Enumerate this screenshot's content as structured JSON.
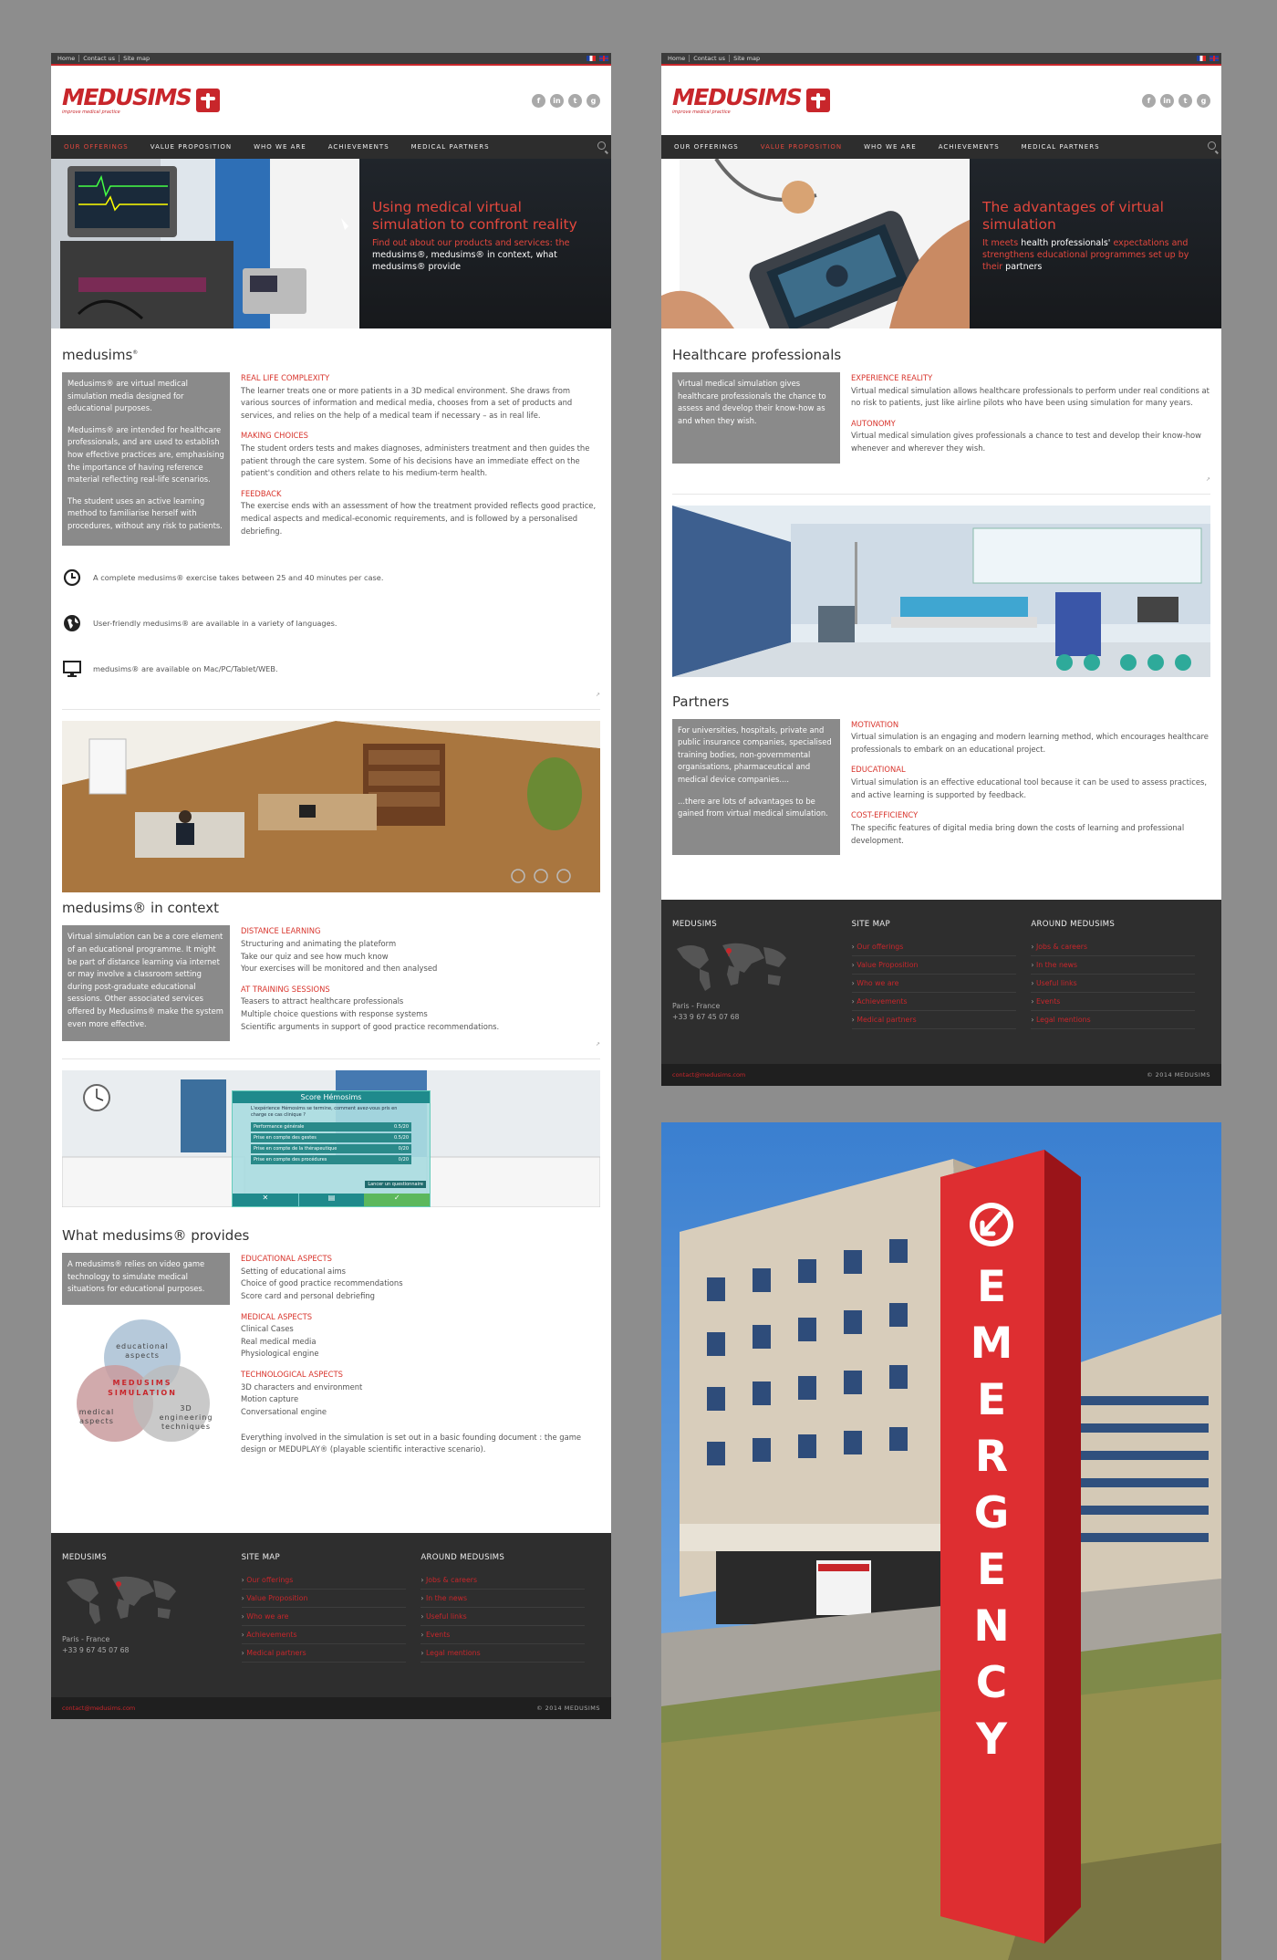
{
  "left_page": {
    "topbar": {
      "links": [
        "Home",
        "Contact us",
        "Site map"
      ]
    },
    "logo": {
      "wordmark": "MEDUSIMS",
      "tagline": "improve medical practice"
    },
    "social_icons": [
      "facebook-icon",
      "linkedin-icon",
      "twitter-icon",
      "googleplus-icon"
    ],
    "nav": {
      "items": [
        "OUR OFFERINGS",
        "VALUE PROPOSITION",
        "WHO WE ARE",
        "ACHIEVEMENTS",
        "MEDICAL PARTNERS"
      ],
      "active": 0
    },
    "hero": {
      "title": "Using medical virtual simulation to confront reality",
      "sub_red": "Find out about our products and services: the",
      "sub_white": "medusims®, medusims® in context, what medusims® provide"
    },
    "section1": {
      "title": "medusims",
      "grey": [
        "Medusims® are virtual medical simulation media designed for educational purposes.",
        "Medusims® are intended for healthcare professionals, and are used to establish how effective practices are, emphasising the importance of having reference material reflecting real-life scenarios.",
        "The student uses an active learning method to familiarise herself with procedures, without any risk to patients."
      ],
      "items": [
        {
          "title": "REAL LIFE COMPLEXITY",
          "text": "The learner treats one or more patients in a 3D medical environment. She draws from various sources of information and medical media, chooses from a set of products and services, and relies on the help of a medical team if necessary – as in real life."
        },
        {
          "title": "MAKING CHOICES",
          "text": "The student orders tests and makes diagnoses, administers treatment and then guides the patient through the care system. Some of his decisions have an immediate effect on the patient's condition and others relate to his medium-term health."
        },
        {
          "title": "FEEDBACK",
          "text": "The exercise ends with an assessment of how the treatment provided reflects good practice, medical aspects and medical-economic requirements, and is followed by a personalised debriefing."
        }
      ]
    },
    "info": [
      {
        "icon": "clock-icon",
        "text": "A complete medusims® exercise takes between 25 and 40 minutes per case."
      },
      {
        "icon": "globe-icon",
        "text": "User-friendly medusims® are available in a variety of languages."
      },
      {
        "icon": "monitor-icon",
        "text": "medusims® are available on Mac/PC/Tablet/WEB."
      }
    ],
    "section2": {
      "title": "medusims® in context",
      "grey": "Virtual simulation can be a core element of an educational programme. It might be part of distance learning via internet or may involve a classroom setting during post-graduate educational sessions. Other associated services offered by Medusims® make the system even more effective.",
      "items": [
        {
          "title": "DISTANCE LEARNING",
          "lines": [
            "Structuring and animating the plateform",
            "Take our quiz and see how much know",
            "Your exercises will be monitored and then analysed"
          ]
        },
        {
          "title": "AT TRAINING SESSIONS",
          "lines": [
            "Teasers to attract healthcare professionals",
            "Multiple choice questions with response systems",
            "Scientific arguments in support of good practice recommendations."
          ]
        }
      ]
    },
    "score_panel": {
      "title": "Score Hémosims",
      "question": "L'expérience Hémosims se termine, comment avez-vous pris en charge ce cas clinique ?",
      "rows": [
        {
          "label": "Performance générale",
          "score": "0.5/20"
        },
        {
          "label": "Prise en compte des gestes",
          "score": "0.5/20"
        },
        {
          "label": "Prise en compte de la thérapeutique",
          "score": "0/20"
        },
        {
          "label": "Prise en compte des procédures",
          "score": "0/20"
        }
      ],
      "button": "Lancer un questionnaire"
    },
    "section3": {
      "title": "What medusims® provides",
      "grey": "A medusims® relies on video game technology to simulate medical situations for educational purposes.",
      "venn": {
        "top": "educational aspects",
        "center": "MEDUSIMS SIMULATION",
        "left": "medical aspects",
        "right": "3D engineering techniques"
      },
      "items": [
        {
          "title": "EDUCATIONAL ASPECTS",
          "lines": [
            "Setting of educational aims",
            "Choice of good practice recommendations",
            "Score card and personal debriefing"
          ]
        },
        {
          "title": "MEDICAL ASPECTS",
          "lines": [
            "Clinical Cases",
            "Real medical media",
            "Physiological engine"
          ]
        },
        {
          "title": "TECHNOLOGICAL ASPECTS",
          "lines": [
            "3D characters and environment",
            "Motion capture",
            "Conversational engine"
          ]
        }
      ],
      "closing": "Everything involved in the simulation is set out in a basic founding document : the game design or MEDUPLAY® (playable scientific interactive scenario)."
    }
  },
  "right_page": {
    "nav": {
      "active": 1
    },
    "hero": {
      "title": "The advantages of virtual simulation",
      "sub_a": "It meets",
      "sub_b": "health professionals'",
      "sub_c": "expectations and strengthens educational programmes set up by their",
      "sub_d": "partners"
    },
    "section1": {
      "title": "Healthcare professionals",
      "grey": "Virtual medical simulation gives healthcare professionals the chance to assess and develop their know-how as and when they wish.",
      "items": [
        {
          "title": "EXPERIENCE REALITY",
          "text": "Virtual medical simulation allows healthcare professionals to perform under real conditions at no risk to patients, just like airline pilots who have been using simulation for many years."
        },
        {
          "title": "AUTONOMY",
          "text": "Virtual medical simulation gives professionals a chance to test and develop their know-how whenever and wherever they wish."
        }
      ]
    },
    "section2": {
      "title": "Partners",
      "grey1": "For universities, hospitals, private and public insurance companies, specialised training bodies, non-governmental organisations, pharmaceutical and medical device companies....",
      "grey2": "...there are lots of advantages to be gained from virtual medical simulation.",
      "items": [
        {
          "title": "MOTIVATION",
          "text": "Virtual simulation is an engaging and modern learning method, which encourages healthcare professionals to embark on an educational project."
        },
        {
          "title": "EDUCATIONAL",
          "text": "Virtual simulation is an effective educational tool because it can be used to assess practices, and active learning is supported by feedback."
        },
        {
          "title": "COST-EFFICIENCY",
          "text": "The specific features of digital media bring down the costs of learning and professional development."
        }
      ]
    }
  },
  "footer": {
    "col1_title": "MEDUSIMS",
    "address": [
      "Paris - France",
      "+33 9 67 45 07 68"
    ],
    "col2_title": "SITE MAP",
    "sitemap": [
      "Our offerings",
      "Value Proposition",
      "Who we are",
      "Achievements",
      "Medical partners"
    ],
    "col3_title": "AROUND MEDUSIMS",
    "around": [
      "Jobs & careers",
      "In the news",
      "Useful links",
      "Events",
      "Legal mentions"
    ],
    "email": "contact@medusims.com",
    "copyright": "© 2014 MEDUSIMS"
  },
  "photo": {
    "sign_text": "EMERGENCY"
  },
  "colors": {
    "accent": "#c8262b",
    "dark": "#2e2e2e",
    "grey_box": "#8a8a8a",
    "background": "#8d8d8d"
  }
}
